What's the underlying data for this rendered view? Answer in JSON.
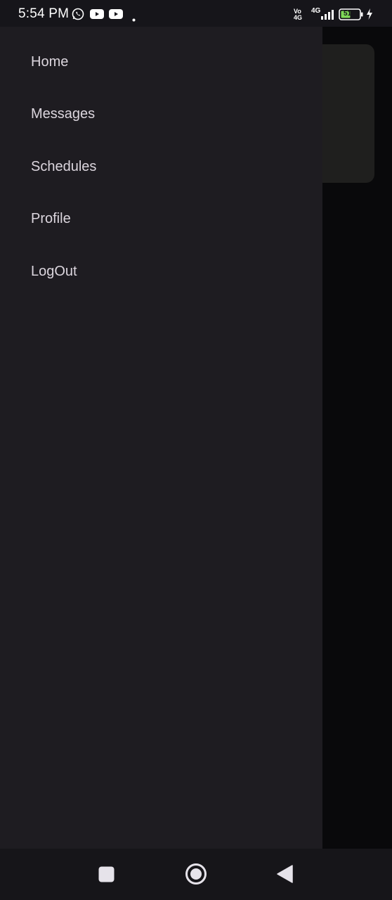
{
  "status_bar": {
    "time": "5:54 PM",
    "sim1_label_top": "Vo",
    "sim1_label_bottom": "4G",
    "sim2_label": "4G",
    "battery_level": "51"
  },
  "drawer": {
    "items": [
      {
        "label": "Home"
      },
      {
        "label": "Messages"
      },
      {
        "label": "Schedules"
      },
      {
        "label": "Profile"
      },
      {
        "label": "LogOut"
      }
    ]
  },
  "nav_bar": {
    "buttons": [
      "recents-square-icon",
      "home-circle-icon",
      "back-triangle-icon"
    ]
  },
  "colors": {
    "drawer_bg": "#1e1c21",
    "text": "#dcd6de",
    "status_bg": "#16151a",
    "battery_accent": "#7ed957"
  }
}
